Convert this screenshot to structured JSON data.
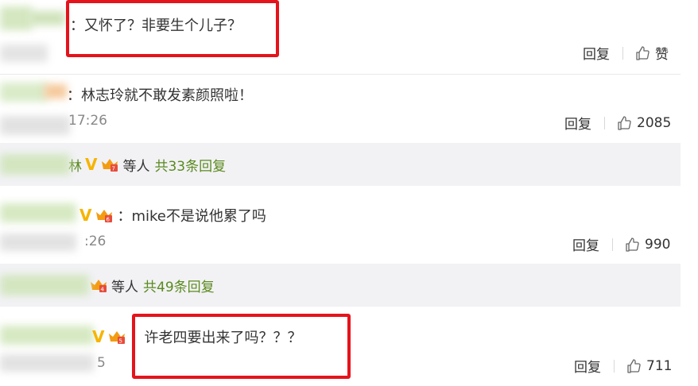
{
  "comments": [
    {
      "text": "：又怀了？非要生个儿子？",
      "time": "",
      "like": "赞"
    },
    {
      "text": "：林志玲就不敢发素颜照啦！",
      "time": "17:26",
      "like": "2085"
    },
    {
      "text": "：mike不是说他累了吗",
      "time": ":26",
      "like": "990"
    },
    {
      "text": "：许老四要出来了吗？？？",
      "time": "5",
      "like": "711"
    }
  ],
  "reply_label": "回复",
  "reply_bars": [
    {
      "name": "林",
      "suffix": "等人",
      "more": "共33条回复"
    },
    {
      "suffix": "等人",
      "more": "共49条回复"
    }
  ],
  "badge_v": "V",
  "icons": {
    "like": "thumbs-up-icon",
    "vip": "crown-badge-icon"
  },
  "colors": {
    "highlight": "#e5131b",
    "link": "#5a8a1e",
    "vip": "#f6b400"
  }
}
